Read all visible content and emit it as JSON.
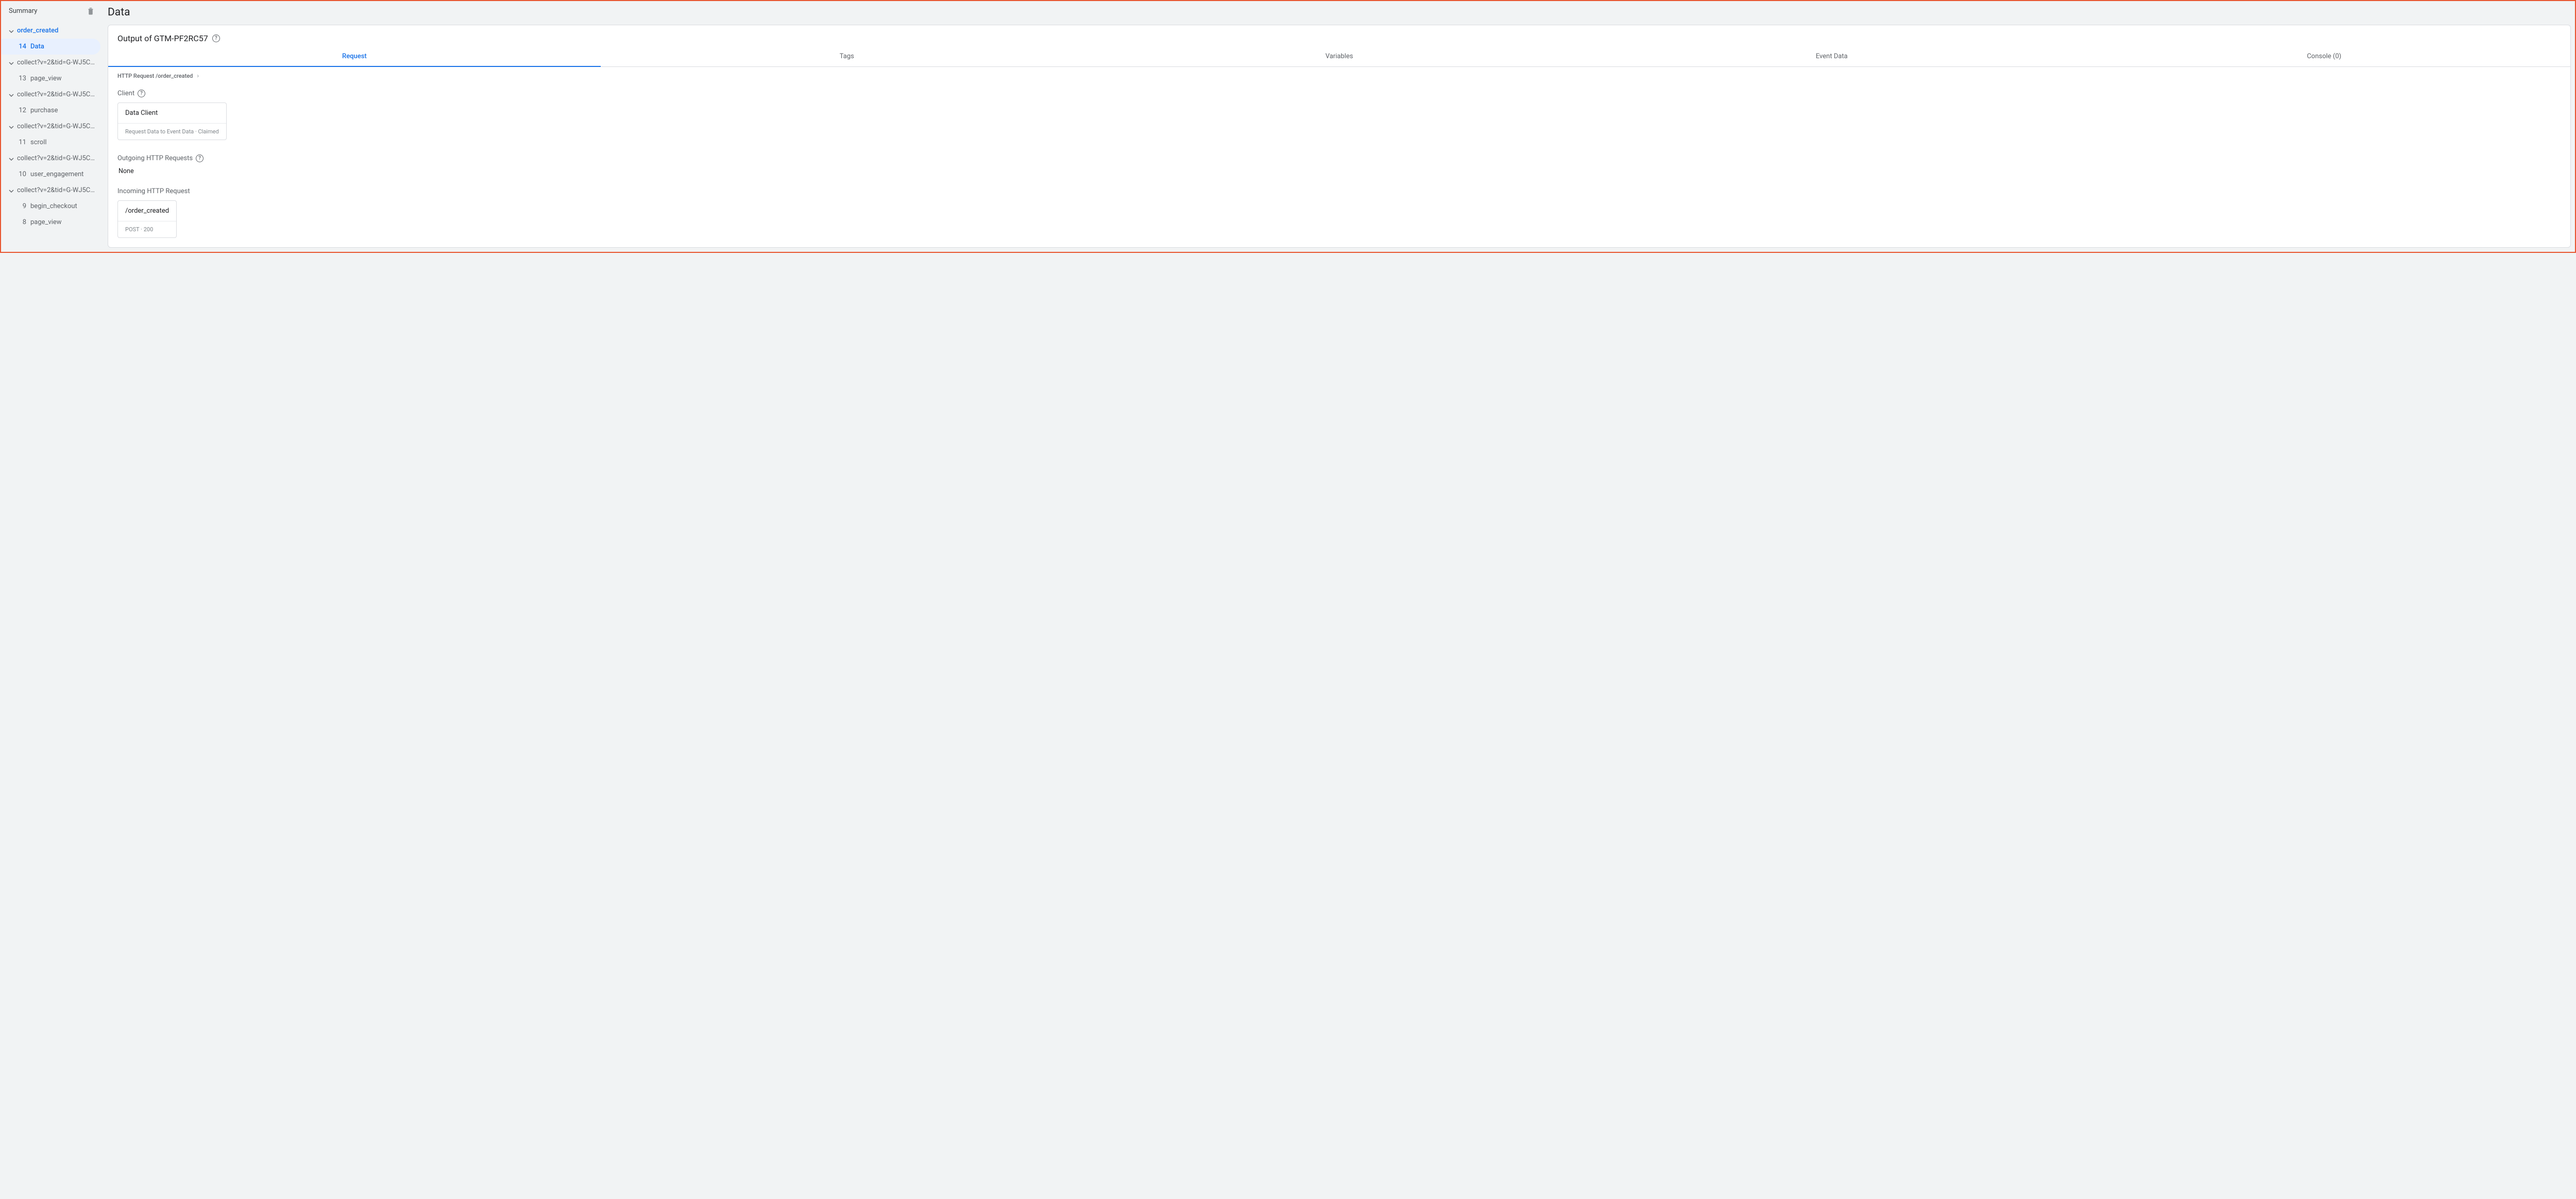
{
  "sidebar": {
    "summary_label": "Summary",
    "groups": [
      {
        "label": "order_created",
        "active": true,
        "items": [
          {
            "num": "14",
            "label": "Data",
            "selected": true
          }
        ]
      },
      {
        "label": "collect?v=2&tid=G-WJ5CL...",
        "items": [
          {
            "num": "13",
            "label": "page_view"
          }
        ]
      },
      {
        "label": "collect?v=2&tid=G-WJ5CL...",
        "items": [
          {
            "num": "12",
            "label": "purchase"
          }
        ]
      },
      {
        "label": "collect?v=2&tid=G-WJ5CL...",
        "items": [
          {
            "num": "11",
            "label": "scroll"
          }
        ]
      },
      {
        "label": "collect?v=2&tid=G-WJ5CL...",
        "items": [
          {
            "num": "10",
            "label": "user_engagement"
          }
        ]
      },
      {
        "label": "collect?v=2&tid=G-WJ5CL...",
        "items": [
          {
            "num": "9",
            "label": "begin_checkout"
          },
          {
            "num": "8",
            "label": "page_view"
          }
        ]
      }
    ]
  },
  "page_title": "Data",
  "panel_title": "Output of GTM-PF2RC57",
  "tabs": [
    {
      "label": "Request",
      "active": true
    },
    {
      "label": "Tags"
    },
    {
      "label": "Variables"
    },
    {
      "label": "Event Data"
    },
    {
      "label": "Console (0)"
    }
  ],
  "breadcrumb": "HTTP Request /order_created",
  "client_label": "Client",
  "client_card": {
    "name": "Data Client",
    "sub": "Request Data to Event Data · Claimed"
  },
  "outgoing_label": "Outgoing HTTP Requests",
  "outgoing_none": "None",
  "incoming_label": "Incoming HTTP Request",
  "incoming_card": {
    "path": "/order_created",
    "sub": "POST · 200"
  }
}
